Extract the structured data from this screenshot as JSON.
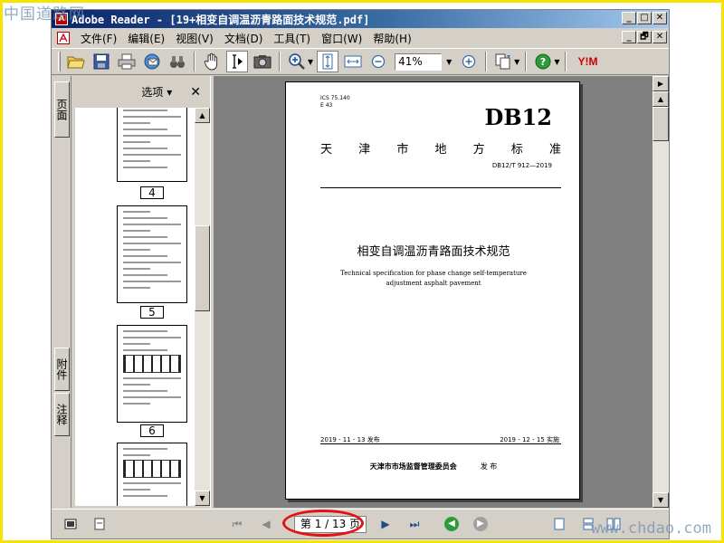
{
  "watermark": {
    "top": "中国道路网",
    "bottom": "www.chdao.com"
  },
  "titlebar": {
    "app_icon": "A",
    "title": "Adobe Reader - [19+相变自调温沥青路面技术规范.pdf]"
  },
  "window_buttons": {
    "minimize": "_",
    "maximize": "□",
    "close": "✕",
    "doc_minimize": "_",
    "doc_restore": "🗗",
    "doc_close": "✕"
  },
  "menu": {
    "items": [
      "文件(F)",
      "编辑(E)",
      "视图(V)",
      "文档(D)",
      "工具(T)",
      "窗口(W)",
      "帮助(H)"
    ]
  },
  "toolbar": {
    "zoom_value": "41%",
    "icons": [
      "open-folder-icon",
      "save-icon",
      "print-icon",
      "email-icon",
      "search-binoculars-icon",
      "hand-tool-icon",
      "select-text-icon",
      "snapshot-icon",
      "zoom-in-icon",
      "fit-page-icon",
      "fit-width-icon",
      "zoom-out-minus-icon",
      "zoom-in-plus-icon",
      "pages-icon",
      "help-icon",
      "yahoo-icon"
    ],
    "yahoo_label": "Y!M"
  },
  "nav_tabs": {
    "pages": "页面",
    "attachments": "附件",
    "comments": "注释"
  },
  "thumbnail_panel": {
    "options_label": "选项 ▾",
    "close": "✕",
    "thumbs": [
      {
        "page": "4"
      },
      {
        "page": "5"
      },
      {
        "page": "6"
      },
      {
        "page": ""
      }
    ]
  },
  "document": {
    "ics_line1": "ICS 75.140",
    "ics_line2": "E 43",
    "standard_code": "DB12",
    "standard_region": [
      "天",
      "津",
      "市",
      "地",
      "方",
      "标",
      "准"
    ],
    "doc_number": "DB12/T 912—2019",
    "title_cn": "相变自调温沥青路面技术规范",
    "title_en": "Technical specification for phase change self-temperature adjustment asphalt pavement",
    "release_date": "2019 - 11 - 13 发布",
    "effective_date": "2019 - 12 - 15 实施",
    "issuer": "天津市市场监督管理委员会",
    "issuer_suffix": "发 布"
  },
  "statusbar": {
    "page_indicator": "第 1 / 13 页"
  },
  "colors": {
    "highlight": "#e21212",
    "frame": "#f5e400",
    "titlebar": "#0a246a"
  }
}
